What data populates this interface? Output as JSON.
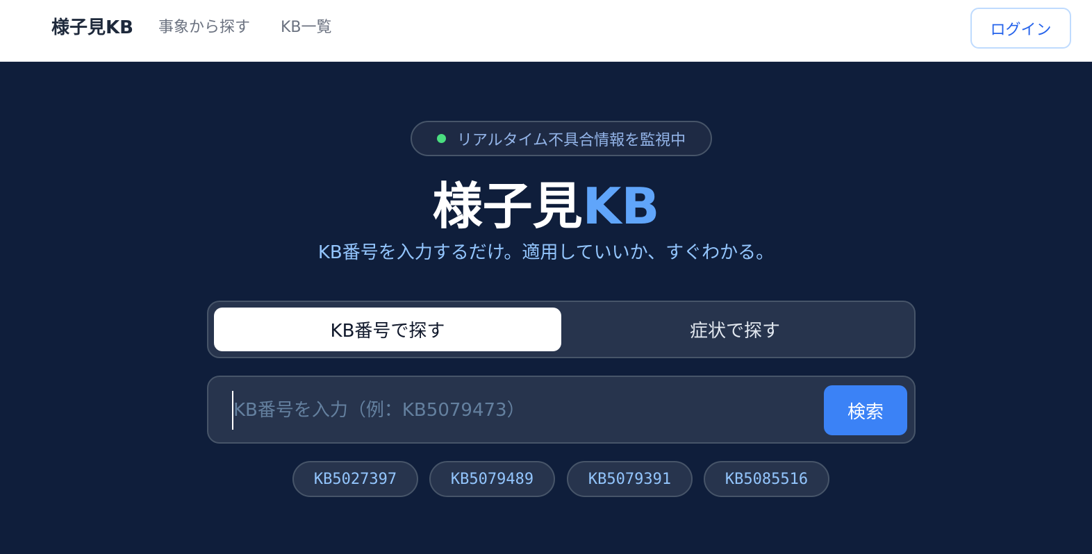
{
  "header": {
    "brand": "様子見KB",
    "nav": [
      {
        "label": "事象から探す"
      },
      {
        "label": "KB一覧"
      }
    ],
    "login_label": "ログイン"
  },
  "hero": {
    "status_text": "リアルタイム不具合情報を監視中",
    "title_main": "様子見",
    "title_accent": "KB",
    "subtitle": "KB番号を入力するだけ。適用していいか、すぐわかる。"
  },
  "tabs": [
    {
      "label": "KB番号で探す",
      "active": true
    },
    {
      "label": "症状で探す",
      "active": false
    }
  ],
  "search": {
    "placeholder": "KB番号を入力（例：KB5079473）",
    "value": "",
    "button_label": "検索"
  },
  "quick_links": [
    {
      "label": "KB5027397"
    },
    {
      "label": "KB5079489"
    },
    {
      "label": "KB5079391"
    },
    {
      "label": "KB5085516"
    }
  ],
  "colors": {
    "hero_bg": "#0f1e3b",
    "accent": "#3b82f6",
    "accent_text": "#60a5fa",
    "status_dot": "#4ade80"
  }
}
